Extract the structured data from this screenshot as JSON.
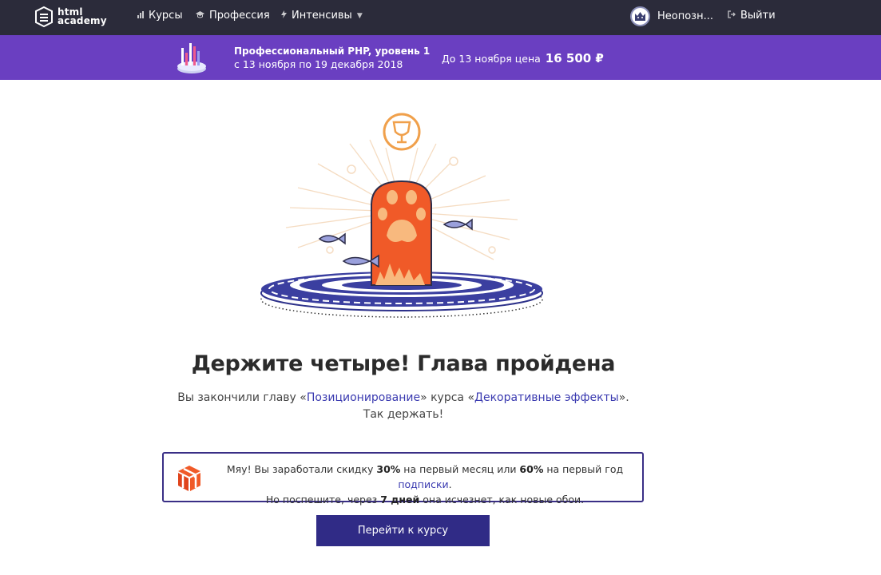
{
  "header": {
    "logo_text": "html\nacademy",
    "nav": [
      {
        "label": "Курсы",
        "icon": "bar-chart-icon"
      },
      {
        "label": "Профессия",
        "icon": "graduation-cap-icon"
      },
      {
        "label": "Интенсивы",
        "icon": "lightning-icon"
      }
    ],
    "user_name": "Неопозн...",
    "logout_label": "Выйти"
  },
  "promo": {
    "course": "Профессиональный PHP, уровень 1",
    "dates": "с 13 ноября по 19 декабря 2018",
    "price_prefix": "До 13 ноября цена",
    "price": "16 500 ₽"
  },
  "main": {
    "headline": "Держите четыре! Глава пройдена",
    "sub_part1": "Вы закончили главу «",
    "chapter_link": "Позиционирование",
    "sub_part2": "» курса «",
    "course_link": "Декоративные эффекты",
    "sub_part3": "».",
    "sub_line2": "Так держать!"
  },
  "notice": {
    "p1": "Мяу! Вы заработали скидку ",
    "discount1": "30%",
    "p2": " на первый месяц или ",
    "discount2": "60%",
    "p3": " на первый год ",
    "link": "подписки",
    "p4": ".",
    "p5": "Но поспешите, через ",
    "days": "7 дней",
    "p6": " она исчезнет, как новые обои."
  },
  "cta_label": "Перейти к курсу",
  "colors": {
    "topbar": "#2b2b3a",
    "promo": "#6a3fc1",
    "accent": "#302b86",
    "paw": "#f05a28",
    "trophy": "#f0a04b"
  }
}
